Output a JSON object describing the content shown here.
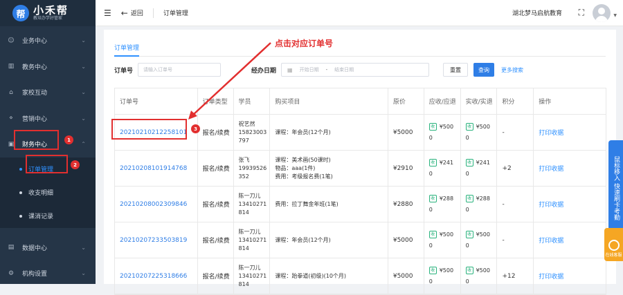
{
  "brand": {
    "mark": "帮",
    "name": "小禾帮",
    "slogan": "教培办学好管家"
  },
  "sidebar": {
    "items": [
      {
        "label": "业务中心",
        "icon": "user-icon"
      },
      {
        "label": "教务中心",
        "icon": "book-icon"
      },
      {
        "label": "家校互动",
        "icon": "school-icon"
      },
      {
        "label": "营销中心",
        "icon": "share-icon"
      },
      {
        "label": "财务中心",
        "icon": "finance-icon"
      }
    ],
    "sub_items": [
      {
        "label": "订单管理"
      },
      {
        "label": "收支明细"
      },
      {
        "label": "课消记录"
      }
    ],
    "bottom_items": [
      {
        "label": "数据中心",
        "icon": "chart-icon"
      },
      {
        "label": "机构设置",
        "icon": "gear-icon"
      }
    ],
    "badges": [
      "1",
      "2"
    ]
  },
  "topbar": {
    "back_label": "返回",
    "page_title": "订单管理",
    "org_name": "湖北梦马启航教育"
  },
  "tab": {
    "label": "订单管理"
  },
  "filter": {
    "order_label": "订单号",
    "order_placeholder": "请输入订单号",
    "operator_label": "经办日期",
    "start_placeholder": "开始日期",
    "dash": "-",
    "end_placeholder": "结束日期",
    "reset_label": "重置",
    "search_label": "查询",
    "more_label": "更多搜索"
  },
  "annotation": {
    "text": "点击对应订单号",
    "badge": "3"
  },
  "table": {
    "headers": [
      "订单号",
      "订单类型",
      "学员",
      "购买项目",
      "原价",
      "应收/应退",
      "实收/实退",
      "积分",
      "操作"
    ],
    "rows": [
      {
        "order_no": "20210210212258101",
        "type": "报名/续费",
        "student": [
          "祝艺然",
          "15823003",
          "797"
        ],
        "items": [
          "课程：年会员(12个月)"
        ],
        "price": "¥5000",
        "due_tag": "收",
        "due": [
          "¥500",
          "0"
        ],
        "paid_tag": "收",
        "paid": [
          "¥500",
          "0"
        ],
        "points": "-",
        "action": "打印收据"
      },
      {
        "order_no": "20210208101914768",
        "type": "报名/续费",
        "student": [
          "张飞",
          "19939526",
          "352"
        ],
        "items": [
          "课程：美术画(50课时)",
          "物品：aaa(1件)",
          "费用：考级报名费(1笔)"
        ],
        "price": "¥2910",
        "due_tag": "收",
        "due": [
          "¥241",
          "0"
        ],
        "paid_tag": "收",
        "paid": [
          "¥241",
          "0"
        ],
        "points": "+2",
        "action": "打印收据"
      },
      {
        "order_no": "20210208002309846",
        "type": "报名/续费",
        "student": [
          "陈一刀儿",
          "13410271",
          "814"
        ],
        "items": [
          "费用：拉丁舞金年班(1笔)"
        ],
        "price": "¥2880",
        "due_tag": "收",
        "due": [
          "¥288",
          "0"
        ],
        "paid_tag": "收",
        "paid": [
          "¥288",
          "0"
        ],
        "points": "-",
        "action": "打印收据"
      },
      {
        "order_no": "20210207233503819",
        "type": "报名/续费",
        "student": [
          "陈一刀儿",
          "13410271",
          "814"
        ],
        "items": [
          "课程：年会员(12个月)"
        ],
        "price": "¥5000",
        "due_tag": "收",
        "due": [
          "¥500",
          "0"
        ],
        "paid_tag": "收",
        "paid": [
          "¥500",
          "0"
        ],
        "points": "-",
        "action": "打印收据"
      },
      {
        "order_no": "20210207225318666",
        "type": "报名/续费",
        "student": [
          "陈一刀儿",
          "13410271",
          "814"
        ],
        "items": [
          "课程：跆拳道(初级)(10个月)"
        ],
        "price": "¥5000",
        "due_tag": "收",
        "due": [
          "¥500",
          "0"
        ],
        "paid_tag": "收",
        "paid": [
          "¥500",
          "0"
        ],
        "points": "+12",
        "action": "打印收据"
      }
    ]
  },
  "float": {
    "bar_text": "鼠标移入 快速刷卡考勤",
    "service_text": "在线客服"
  },
  "colors": {
    "sidebar": "#253547",
    "primary": "#2f7ee6",
    "annotation": "#e22f2f"
  }
}
